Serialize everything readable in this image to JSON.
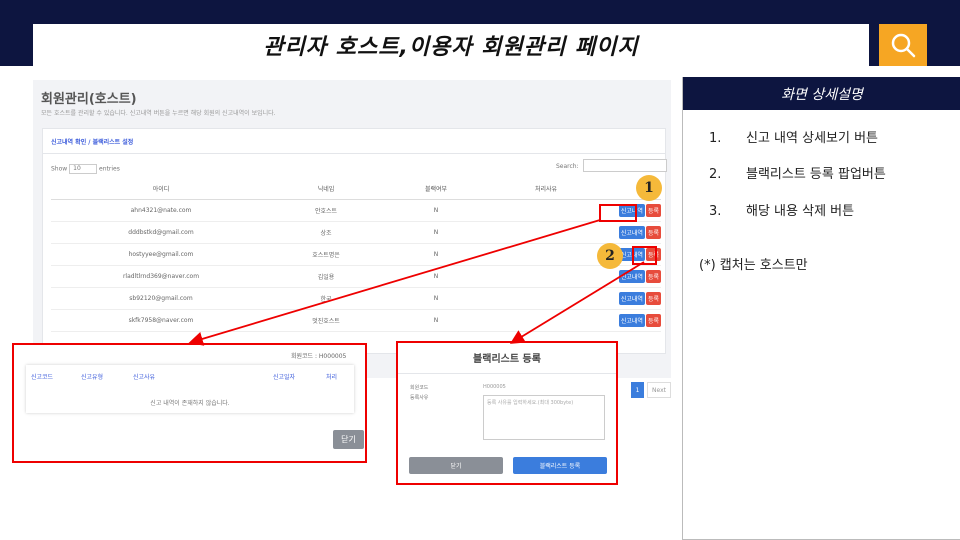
{
  "header": {
    "title": "관리자 호스트,이용자 회원관리 페이지"
  },
  "screenshot": {
    "page_title": "회원관리(호스트)",
    "description": "모든 호스트를 관리할 수 있습니다. 신고내역 버튼을 누르면 해당 회원의 신고내역이 보입니다.",
    "tab_label": "신고내역 확인 / 블랙리스트 설정",
    "show_label": "Show",
    "show_value": "10",
    "entries_label": "entries",
    "search_label": "Search:",
    "columns": [
      "아이디",
      "닉네임",
      "블랙여부",
      "처리사유",
      "처리"
    ],
    "rows": [
      {
        "id": "ahn4321@nate.com",
        "nick": "안호스트",
        "black": "N"
      },
      {
        "id": "dddbstkd@gmail.com",
        "nick": "상조",
        "black": "N"
      },
      {
        "id": "hostyyee@gmail.com",
        "nick": "호스트명은",
        "black": "N"
      },
      {
        "id": "rladltlrnd369@naver.com",
        "nick": "김일용",
        "black": "N"
      },
      {
        "id": "sb92120@gmail.com",
        "nick": "한국",
        "black": "N"
      },
      {
        "id": "skfk7958@naver.com",
        "nick": "멋진호스트",
        "black": "N"
      }
    ],
    "report_btn": "신고내역",
    "register_btn": "등록",
    "page_num": "1",
    "next_label": "Next"
  },
  "callouts": [
    "1",
    "2"
  ],
  "report_modal": {
    "member_code": "회원코드 : H000005",
    "headers": [
      "신고코드",
      "신고유형",
      "신고사유",
      "신고일자",
      "처리"
    ],
    "empty_text": "신고 내역이 존재하지 않습니다.",
    "close_label": "닫기"
  },
  "blacklist_modal": {
    "title": "블랙리스트 등록",
    "member_code_label": "회원코드",
    "member_code_value": "H000005",
    "reason_label": "등록사유",
    "reason_placeholder": "등록 사유를 입력하세요.(최대 300byte)",
    "close_label": "닫기",
    "submit_label": "블랙리스트 등록"
  },
  "panel": {
    "title": "화면 상세설명",
    "items": [
      {
        "num": "1.",
        "text": "신고 내역 상세보기 버튼"
      },
      {
        "num": "2.",
        "text": "블랙리스트 등록 팝업버튼"
      },
      {
        "num": "3.",
        "text": "해당 내용 삭제 버튼"
      }
    ],
    "note": "(*) 캡처는 호스트만"
  },
  "colors": {
    "navy": "#0d1540",
    "accent_orange": "#f6a623",
    "highlight_red": "#e00000",
    "button_blue": "#3b7ddd",
    "button_red": "#e74c3c"
  },
  "icons": {
    "search": "search-icon"
  }
}
